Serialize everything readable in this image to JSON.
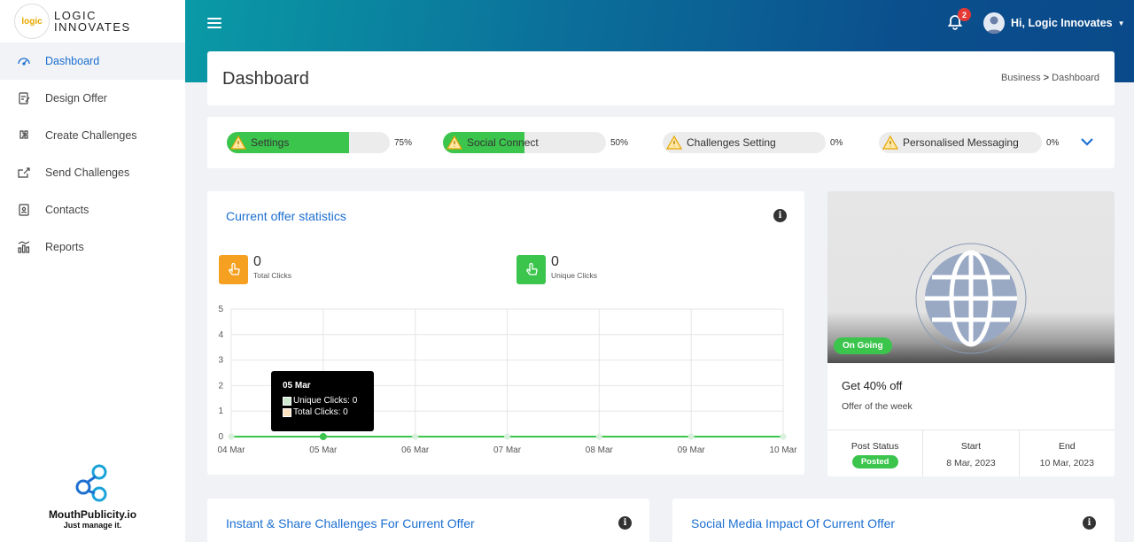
{
  "brand": {
    "logo_text": "logic",
    "name_line1": "LOGIC",
    "name_line2": "INNOVATES"
  },
  "sidebar": {
    "items": [
      {
        "label": "Dashboard",
        "icon": "speedometer-icon",
        "active": true
      },
      {
        "label": "Design Offer",
        "icon": "edit-document-icon"
      },
      {
        "label": "Create Challenges",
        "icon": "puzzle-icon"
      },
      {
        "label": "Send Challenges",
        "icon": "share-icon"
      },
      {
        "label": "Contacts",
        "icon": "contact-book-icon"
      },
      {
        "label": "Reports",
        "icon": "bar-chart-icon"
      }
    ],
    "footer": {
      "name": "MouthPublicity.io",
      "tagline": "Just manage it."
    }
  },
  "topbar": {
    "notifications_count": "2",
    "user_greeting": "Hi, Logic Innovates"
  },
  "header": {
    "title": "Dashboard",
    "breadcrumb_parent": "Business",
    "breadcrumb_sep": " > ",
    "breadcrumb_current": "Dashboard"
  },
  "progress": [
    {
      "label": "Settings",
      "percent_text": "75%",
      "percent": 0.75
    },
    {
      "label": "Social Connect",
      "percent_text": "50%",
      "percent": 0.5
    },
    {
      "label": "Challenges Setting",
      "percent_text": "0%",
      "percent": 0
    },
    {
      "label": "Personalised Messaging",
      "percent_text": "0%",
      "percent": 0
    }
  ],
  "stats": {
    "title": "Current offer statistics",
    "total_clicks": {
      "value": "0",
      "label": "Total Clicks",
      "color": "#f5a020"
    },
    "unique_clicks": {
      "value": "0",
      "label": "Unique Clicks",
      "color": "#3bc54d"
    },
    "tooltip": {
      "title": "05 Mar",
      "row1": "Unique Clicks: 0",
      "row2": "Total Clicks: 0"
    }
  },
  "chart_data": {
    "type": "line",
    "categories": [
      "04 Mar",
      "05 Mar",
      "06 Mar",
      "07 Mar",
      "08 Mar",
      "09 Mar",
      "10 Mar"
    ],
    "series": [
      {
        "name": "Unique Clicks",
        "values": [
          0,
          0,
          0,
          0,
          0,
          0,
          0
        ],
        "color": "#3bc54d"
      },
      {
        "name": "Total Clicks",
        "values": [
          0,
          0,
          0,
          0,
          0,
          0,
          0
        ],
        "color": "#f5a020"
      }
    ],
    "ylim": [
      0,
      5
    ],
    "yticks": [
      0,
      1,
      2,
      3,
      4,
      5
    ],
    "grid": true
  },
  "offer": {
    "status_badge": "On Going",
    "title": "Get 40% off",
    "subtitle": "Offer of the week",
    "post_status_label": "Post Status",
    "post_status_value": "Posted",
    "start_label": "Start",
    "start_value": "8 Mar, 2023",
    "end_label": "End",
    "end_value": "10 Mar, 2023"
  },
  "bottom": {
    "left_title": "Instant & Share Challenges For Current Offer",
    "right_title": "Social Media Impact Of Current Offer"
  },
  "colors": {
    "accent": "#1c6fd1",
    "success": "#3bc54d",
    "warning": "#f5a020",
    "danger": "#e53935"
  }
}
